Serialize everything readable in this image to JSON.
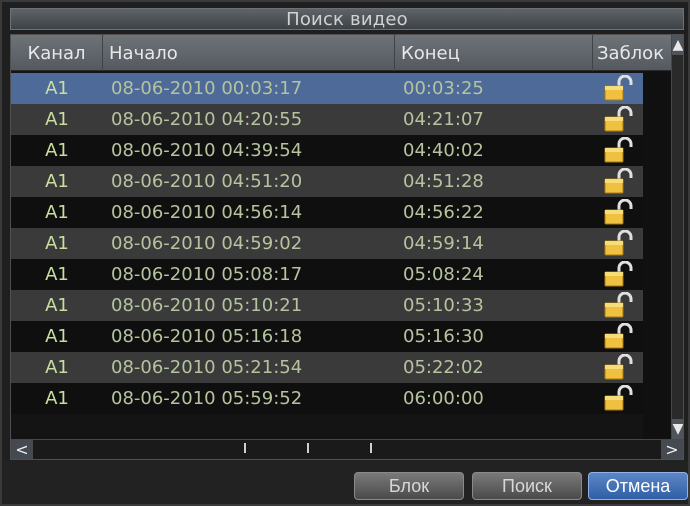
{
  "window": {
    "title": "Поиск видео"
  },
  "table": {
    "columns": {
      "channel": "Канал",
      "start": "Начало",
      "end": "Конец",
      "lock": "Заблок"
    },
    "rows": [
      {
        "channel": "A1",
        "start": "08-06-2010 00:03:17",
        "end": "00:03:25",
        "lock_icon": "unlocked-padlock-icon",
        "selected": true
      },
      {
        "channel": "A1",
        "start": "08-06-2010 04:20:55",
        "end": "04:21:07",
        "lock_icon": "unlocked-padlock-icon",
        "selected": false
      },
      {
        "channel": "A1",
        "start": "08-06-2010 04:39:54",
        "end": "04:40:02",
        "lock_icon": "unlocked-padlock-icon",
        "selected": false
      },
      {
        "channel": "A1",
        "start": "08-06-2010 04:51:20",
        "end": "04:51:28",
        "lock_icon": "unlocked-padlock-icon",
        "selected": false
      },
      {
        "channel": "A1",
        "start": "08-06-2010 04:56:14",
        "end": "04:56:22",
        "lock_icon": "unlocked-padlock-icon",
        "selected": false
      },
      {
        "channel": "A1",
        "start": "08-06-2010 04:59:02",
        "end": "04:59:14",
        "lock_icon": "unlocked-padlock-icon",
        "selected": false
      },
      {
        "channel": "A1",
        "start": "08-06-2010 05:08:17",
        "end": "05:08:24",
        "lock_icon": "unlocked-padlock-icon",
        "selected": false
      },
      {
        "channel": "A1",
        "start": "08-06-2010 05:10:21",
        "end": "05:10:33",
        "lock_icon": "unlocked-padlock-icon",
        "selected": false
      },
      {
        "channel": "A1",
        "start": "08-06-2010 05:16:18",
        "end": "05:16:30",
        "lock_icon": "unlocked-padlock-icon",
        "selected": false
      },
      {
        "channel": "A1",
        "start": "08-06-2010 05:21:54",
        "end": "05:22:02",
        "lock_icon": "unlocked-padlock-icon",
        "selected": false
      },
      {
        "channel": "A1",
        "start": "08-06-2010 05:59:52",
        "end": "06:00:00",
        "lock_icon": "unlocked-padlock-icon",
        "selected": false
      }
    ]
  },
  "scrollbar": {
    "up_icon": "chevron-up-icon",
    "down_icon": "chevron-down-icon",
    "left_label": "<",
    "right_label": ">"
  },
  "buttons": {
    "lock": "Блок",
    "search": "Поиск",
    "cancel": "Отмена"
  },
  "colors": {
    "selected_row": "#4d6a99",
    "active_button": "#2f5fa5"
  }
}
